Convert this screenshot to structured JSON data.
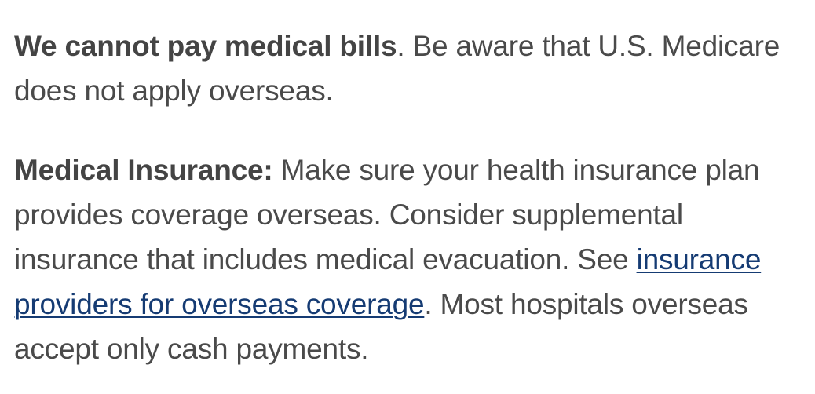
{
  "section_medical": {
    "bills": {
      "bold": "We cannot pay medical bills",
      "rest": ". Be aware that U.S. Medicare does not apply overseas."
    },
    "insurance": {
      "bold": "Medical Insurance:",
      "text_before_link": " Make sure your health insurance plan provides coverage overseas. Consider supplemental insurance that includes medical evacuation. See ",
      "link_text": "insurance providers for overseas coverage",
      "text_after_link": ". Most hospitals overseas accept only cash payments."
    }
  },
  "colors": {
    "text": "#4a4a4a",
    "link": "#153b73",
    "background": "#ffffff"
  }
}
